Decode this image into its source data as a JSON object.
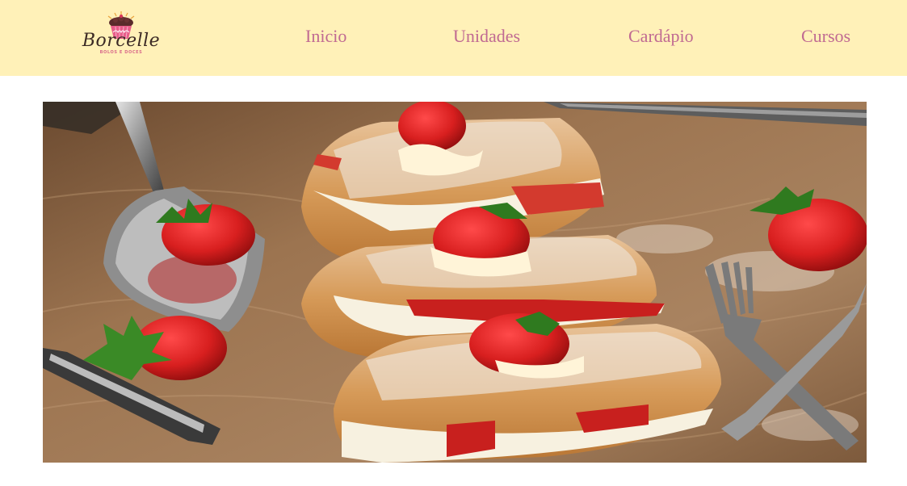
{
  "header": {
    "background": "#fff1b8",
    "logo": {
      "name": "Borcelle",
      "tagline": "BOLOS E DOCES",
      "icon": "cupcake-icon"
    }
  },
  "nav": {
    "color": "#c06a92",
    "items": [
      {
        "label": "Inicio"
      },
      {
        "label": "Unidades"
      },
      {
        "label": "Cardápio"
      },
      {
        "label": "Cursos"
      }
    ]
  },
  "hero": {
    "image": "strawberry-cream-eclairs-photo"
  }
}
